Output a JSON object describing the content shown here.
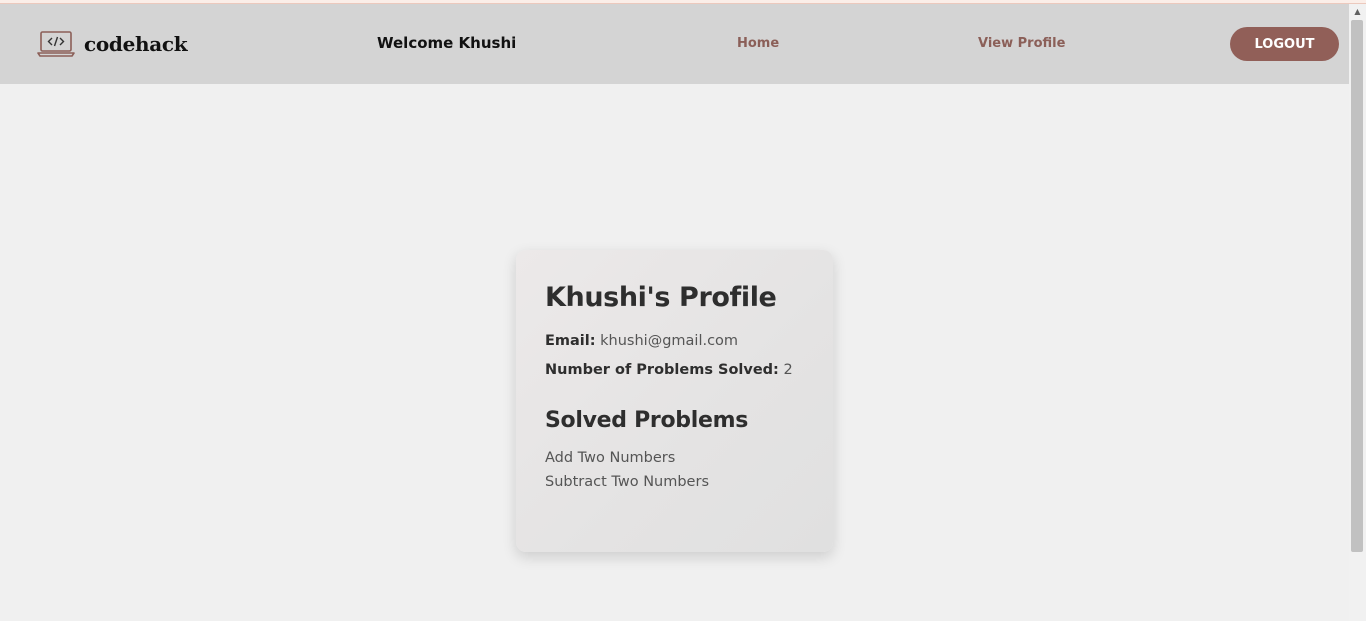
{
  "navbar": {
    "logo_text": "codehack",
    "welcome": "Welcome Khushi",
    "links": [
      {
        "label": "Home"
      },
      {
        "label": "View Profile"
      }
    ],
    "logout_label": "LOGOUT"
  },
  "profile": {
    "title": "Khushi's Profile",
    "email_label": "Email:",
    "email": "khushi@gmail.com",
    "solved_count_label": "Number of Problems Solved:",
    "solved_count": "2",
    "solved_title": "Solved Problems",
    "problems": [
      "Add Two Numbers",
      "Subtract Two Numbers"
    ]
  },
  "colors": {
    "navbar_bg": "#d4d4d4",
    "accent": "#915f58",
    "page_bg": "#f0f0f0"
  },
  "icons": {
    "logo": "laptop-code-icon",
    "scroll_up": "triangle-up-icon"
  }
}
